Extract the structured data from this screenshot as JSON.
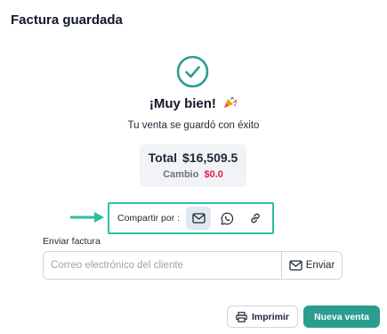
{
  "dialog": {
    "title": "Factura guardada"
  },
  "success": {
    "headline": "¡Muy bien!",
    "message": "Tu venta se guardó con éxito",
    "accent_color": "#2a9d8f"
  },
  "totals": {
    "total_label": "Total",
    "total_value": "$16,509.5",
    "change_label": "Cambio",
    "change_value": "$0.0",
    "change_color": "#e11d48"
  },
  "share": {
    "label": "Compartir por :",
    "options": [
      {
        "icon": "mail-icon",
        "active": true
      },
      {
        "icon": "whatsapp-icon",
        "active": false
      },
      {
        "icon": "link-icon",
        "active": false
      }
    ],
    "highlight_color": "#2bbfa5"
  },
  "send_invoice": {
    "label": "Enviar factura",
    "placeholder": "Correo electrónico del cliente",
    "value": "",
    "button_label": "Enviar",
    "button_icon": "mail-icon"
  },
  "footer": {
    "print_label": "Imprimir",
    "print_icon": "printer-icon",
    "new_sale_label": "Nueva venta"
  }
}
